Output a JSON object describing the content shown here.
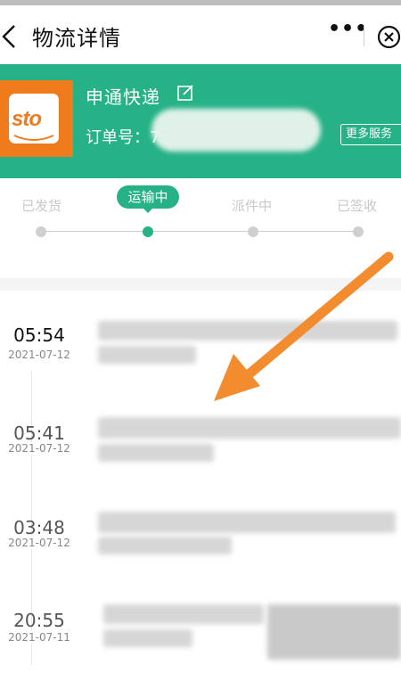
{
  "nav": {
    "title": "物流详情",
    "more_label": "•••"
  },
  "header": {
    "logo_text": "sto",
    "company": "申通快递",
    "order_label": "订单号：7",
    "more_service": "更多服务"
  },
  "steps": [
    {
      "label": "已发货",
      "active": false
    },
    {
      "label": "运输中",
      "active": true
    },
    {
      "label": "派件中",
      "active": false
    },
    {
      "label": "已签收",
      "active": false
    }
  ],
  "timeline": [
    {
      "time": "05:54",
      "date": "2021-07-12"
    },
    {
      "time": "05:41",
      "date": "2021-07-12"
    },
    {
      "time": "03:48",
      "date": "2021-07-12"
    },
    {
      "time": "20:55",
      "date": "2021-07-11"
    }
  ],
  "colors": {
    "brand_green": "#26b186",
    "sto_orange": "#f07b1d",
    "annotation_arrow": "#f28c2f"
  }
}
